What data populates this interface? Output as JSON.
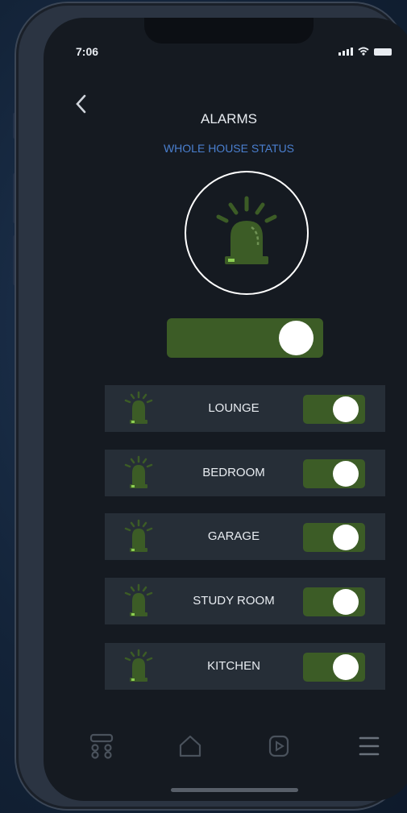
{
  "status_bar": {
    "time": "7:06"
  },
  "header": {
    "back_icon": "chevron-left-icon",
    "title": "ALARMS",
    "subtitle": "WHOLE HOUSE STATUS"
  },
  "master": {
    "icon": "siren-icon",
    "enabled": true
  },
  "rooms": [
    {
      "label": "LOUNGE",
      "enabled": true
    },
    {
      "label": "BEDROOM",
      "enabled": true
    },
    {
      "label": "GARAGE",
      "enabled": true
    },
    {
      "label": "STUDY ROOM",
      "enabled": true
    },
    {
      "label": "KITCHEN",
      "enabled": true
    }
  ],
  "tabbar": {
    "items": [
      {
        "icon": "devices-grid-icon"
      },
      {
        "icon": "home-icon"
      },
      {
        "icon": "media-play-icon"
      },
      {
        "icon": "menu-icon"
      }
    ]
  },
  "colors": {
    "accent_green": "#3c5c26",
    "subtitle_blue": "#4a7fcf",
    "screen_bg": "#151a21",
    "row_bg": "#262e37"
  }
}
